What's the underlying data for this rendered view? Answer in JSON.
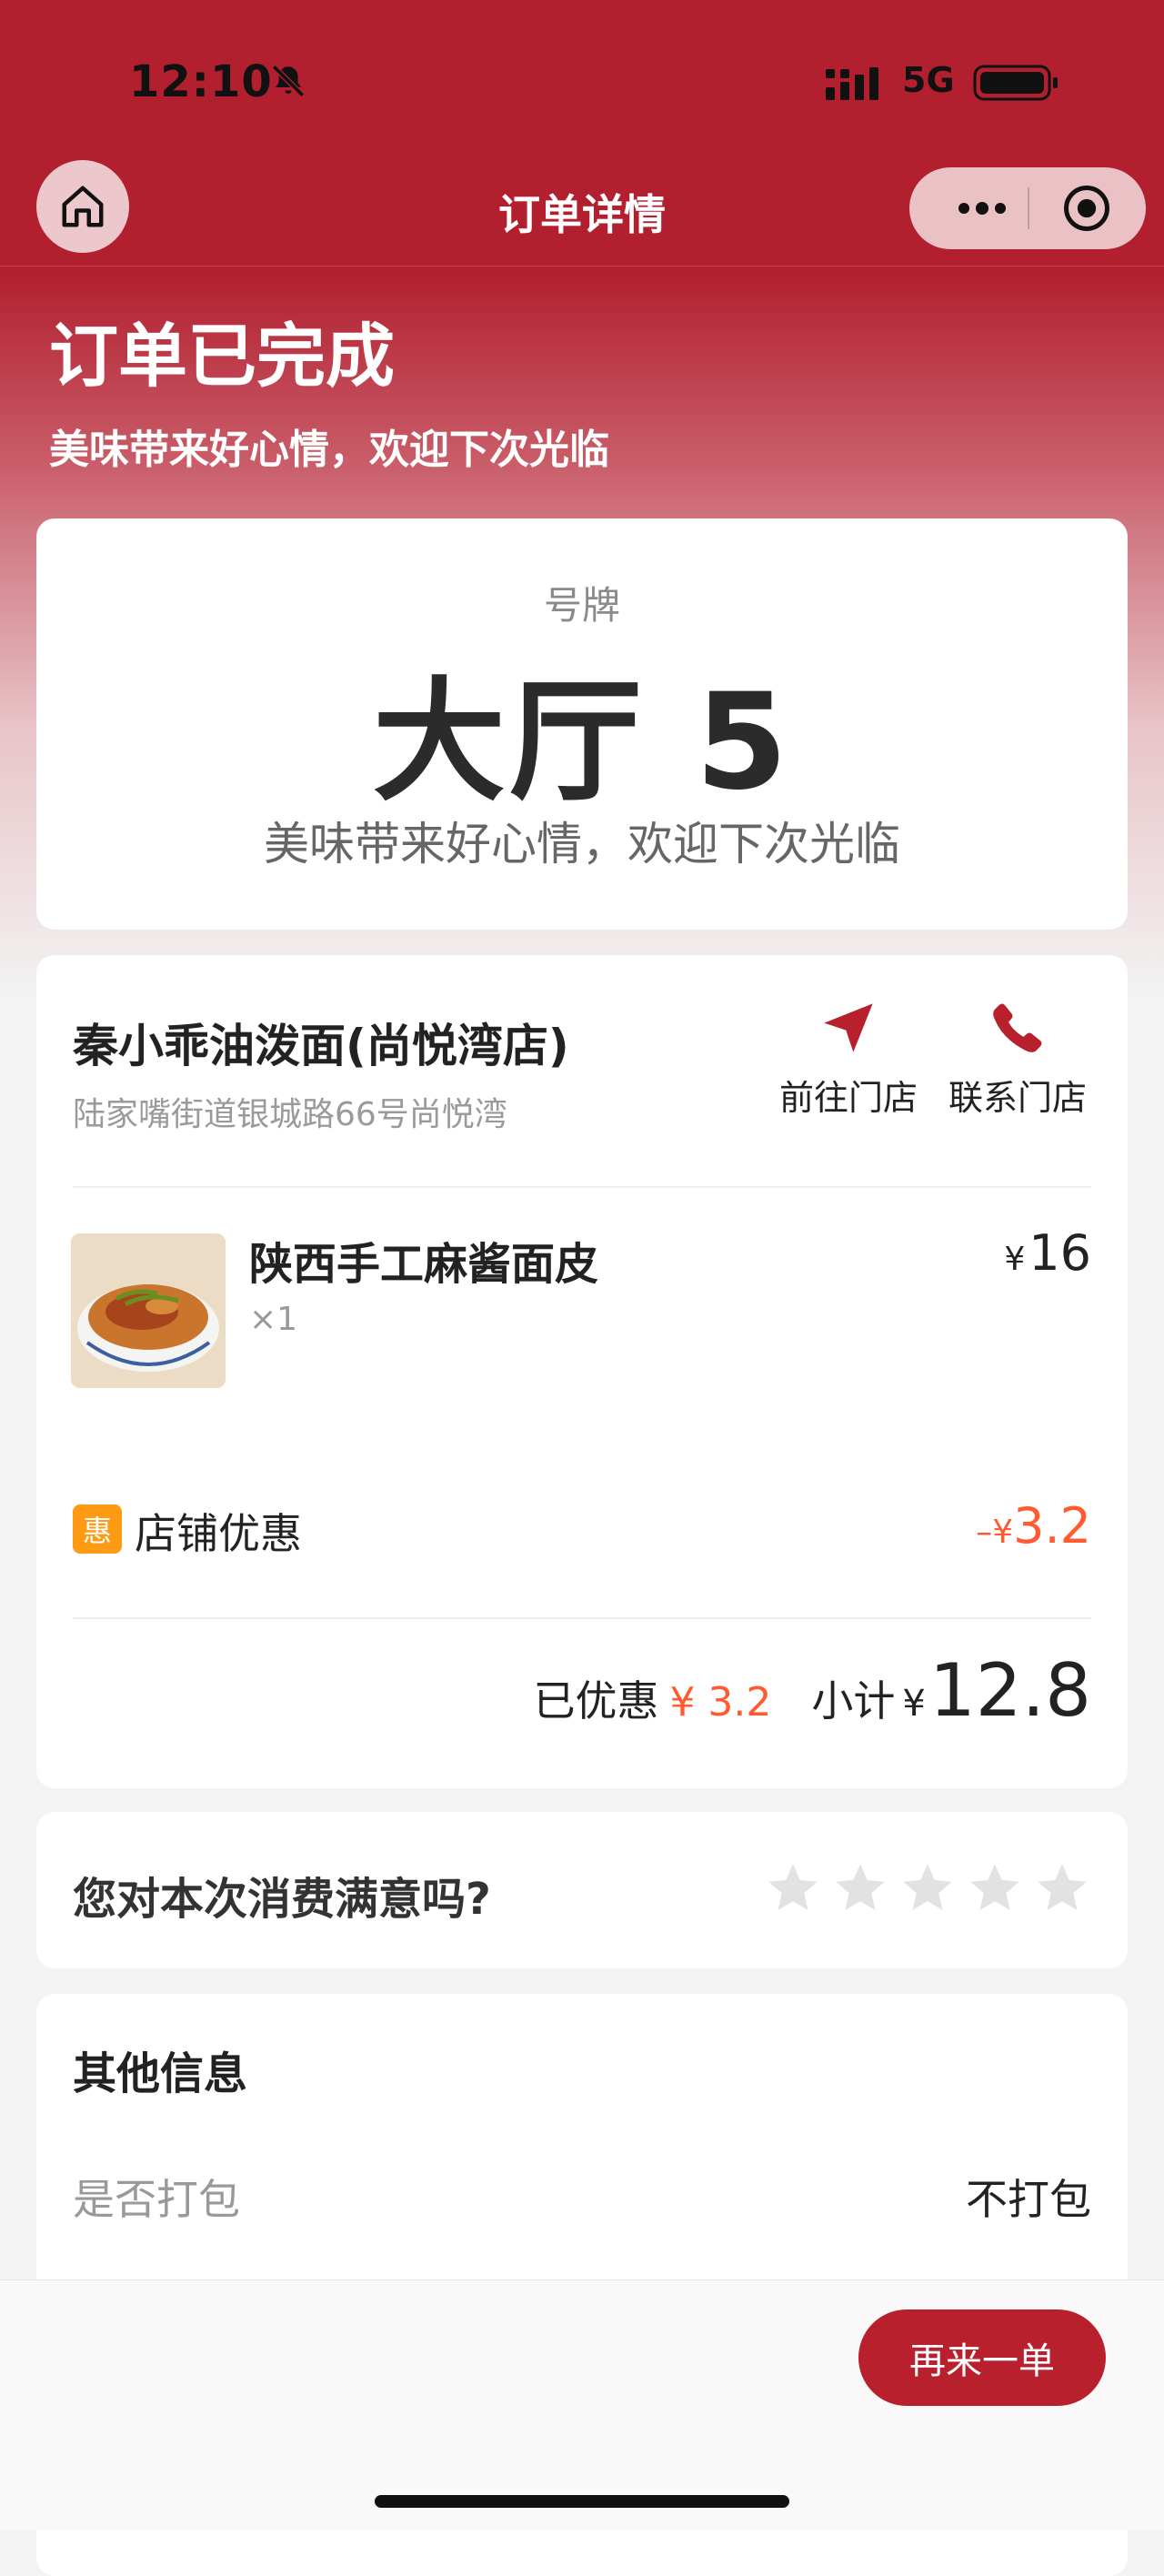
{
  "status_bar": {
    "time": "12:10",
    "network": "5G"
  },
  "nav": {
    "title": "订单详情"
  },
  "order": {
    "status": "订单已完成",
    "subtitle": "美味带来好心情，欢迎下次光临"
  },
  "ticket": {
    "label": "号牌",
    "number": "大厅 5",
    "message": "美味带来好心情，欢迎下次光临"
  },
  "store": {
    "name": "秦小乖油泼面(尚悦湾店)",
    "address": "陆家嘴街道银城路66号尚悦湾",
    "navigate_label": "前往门店",
    "call_label": "联系门店"
  },
  "items": [
    {
      "name": "陕西手工麻酱面皮",
      "qty": "×1",
      "currency": "¥",
      "price": "16"
    }
  ],
  "discount": {
    "badge": "惠",
    "label": "店铺优惠",
    "sign": "–",
    "currency": "¥",
    "amount": "3.2"
  },
  "summary": {
    "saved_label": "已优惠",
    "saved_value": "¥ 3.2",
    "subtotal_label": "小计",
    "currency": "¥",
    "subtotal_value": "12.8"
  },
  "rating": {
    "question": "您对本次消费满意吗?",
    "max_stars": 5,
    "selected_stars": 0
  },
  "other_info": {
    "title": "其他信息",
    "pack_label": "是否打包",
    "pack_value": "不打包"
  },
  "actions": {
    "reorder_label": "再来一单"
  },
  "colors": {
    "brand": "#b22030",
    "discount": "#ff5a30",
    "badge": "#ff9a14"
  }
}
